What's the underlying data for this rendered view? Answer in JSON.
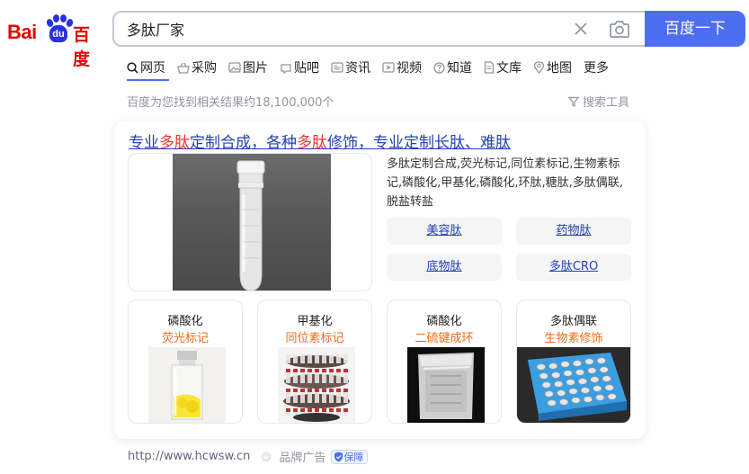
{
  "logo": {
    "latin": "Bai",
    "paw": "du",
    "chinese": "百度"
  },
  "search": {
    "query": "多肽厂家",
    "button_label": "百度一下"
  },
  "tabs": [
    {
      "label": "网页",
      "icon": "search-icon"
    },
    {
      "label": "采购",
      "icon": "shopping-basket-icon"
    },
    {
      "label": "图片",
      "icon": "image-icon"
    },
    {
      "label": "贴吧",
      "icon": "tieba-icon"
    },
    {
      "label": "资讯",
      "icon": "news-icon"
    },
    {
      "label": "视频",
      "icon": "video-icon"
    },
    {
      "label": "知道",
      "icon": "question-icon"
    },
    {
      "label": "文库",
      "icon": "document-icon"
    },
    {
      "label": "地图",
      "icon": "map-pin-icon"
    },
    {
      "label": "更多",
      "icon": ""
    }
  ],
  "result_count": "百度为您找到相关结果约18,100,000个",
  "search_tools": "搜索工具",
  "ad": {
    "title_parts": [
      "专业",
      "多肽",
      "定制合成，各种",
      "多肽",
      "修饰，专业定制长肽、难肽"
    ],
    "description": "多肽定制合成,荧光标记,同位素标记,生物素标记,磷酸化,甲基化,磷酸化,环肽,糖肽,多肽偶联,脱盐转盐",
    "links": [
      "美容肽",
      "药物肽",
      "底物肽",
      "多肽CRO"
    ],
    "products": [
      {
        "title": "磷酸化",
        "subtitle": "荧光标记"
      },
      {
        "title": "甲基化",
        "subtitle": "同位素标记"
      },
      {
        "title": "磷酸化",
        "subtitle": "二硫键成环"
      },
      {
        "title": "多肽偶联",
        "subtitle": "生物素修饰"
      }
    ],
    "source_url": "http://www.hcwsw.cn",
    "brand_label": "品牌广告",
    "guarantee_label": "保障"
  },
  "colors": {
    "brand_blue": "#4e6ef2",
    "link_blue": "#2440b3",
    "highlight_red": "#f73131",
    "orange": "#f06b1a",
    "logo_red": "#e10601",
    "logo_blue": "#2932e1"
  }
}
